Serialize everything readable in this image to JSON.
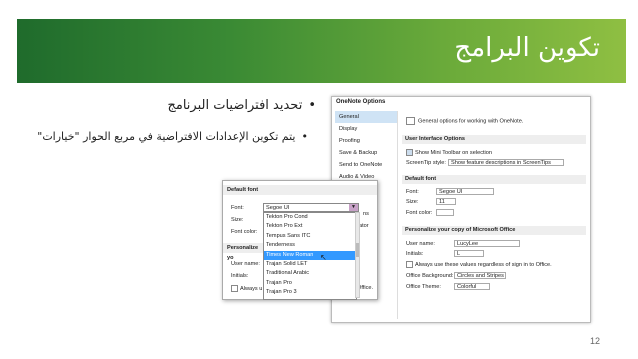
{
  "slide": {
    "title": "تكوين البرامج",
    "bullet1": "تحديد افتراضيات البرنامج",
    "bullet2": "يتم تكوين الإعدادات الافتراضية في مربع الحوار \"خيارات\"",
    "page_number": "12"
  },
  "options_dialog": {
    "title": "OneNote Options",
    "sidebar": [
      "General",
      "Display",
      "Proofing",
      "Save & Backup",
      "Send to OneNote",
      "Audio & Video"
    ],
    "intro": "General options for working with OneNote.",
    "ui_section": "User Interface Options",
    "mini_toolbar": "Show Mini Toolbar on selection",
    "screentip_label": "ScreenTip style:",
    "screentip_value": "Show feature descriptions in ScreenTips",
    "default_font_section": "Default font",
    "font_label": "Font:",
    "font_value": "Segoe UI",
    "size_label": "Size:",
    "size_value": "11",
    "font_color_label": "Font color:",
    "personalize_section": "Personalize your copy of Microsoft Office",
    "username_label": "User name:",
    "username_value": "LucyLee",
    "initials_label": "Initials:",
    "initials_value": "L",
    "always_use_label": "Always use these values regardless of sign in to Office.",
    "background_label": "Office Background:",
    "background_value": "Circles and Stripes",
    "theme_label": "Office Theme:",
    "theme_value": "Colorful"
  },
  "font_popup": {
    "section": "Default font",
    "font_label": "Font:",
    "font_value": "Segoe UI",
    "size_label": "Size:",
    "font_color_label": "Font color:",
    "personalize_label": "Personalize yo",
    "username_label": "User name:",
    "initials_label": "Initials:",
    "always_label": "Always u",
    "dropdown_items": [
      "Tekton Pro Cond",
      "Tekton Pro Ext",
      "Tempus Sans ITC",
      "Tenderness",
      "Times New Roman",
      "Trajan Solid LET",
      "Traditional Arabic",
      "Trajan Pro",
      "Trajan Pro 3"
    ],
    "selected_index": 4,
    "partial_right_1": "ns",
    "partial_right_2": "ator",
    "partial_right_3": "Office."
  }
}
